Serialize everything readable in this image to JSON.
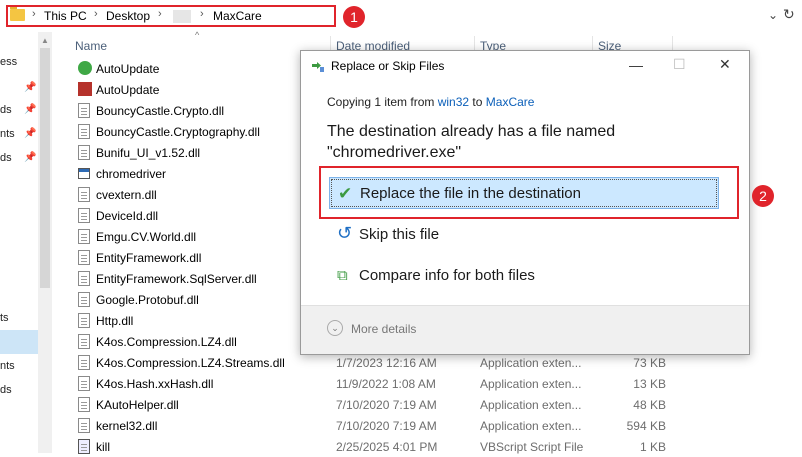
{
  "address": {
    "crumbs": [
      "This PC",
      "Desktop",
      "MaxCare"
    ],
    "separator": "›",
    "refresh_glyph": "↻",
    "dropdown_glyph": "⌄"
  },
  "annotations": {
    "badge1": "1",
    "badge2": "2"
  },
  "nav": {
    "labels": [
      "ess",
      "ds",
      "nts",
      "ds",
      "ts",
      "nts",
      "ds"
    ]
  },
  "columns": {
    "name": "Name",
    "date": "Date modified",
    "type": "Type",
    "size": "Size"
  },
  "files": [
    {
      "name": "AutoUpdate",
      "icon": "green-refresh-icon",
      "date": "",
      "type": "",
      "size": ""
    },
    {
      "name": "AutoUpdate",
      "icon": "red-app-icon",
      "date": "",
      "type": "",
      "size": ""
    },
    {
      "name": "BouncyCastle.Crypto.dll",
      "icon": "dll-file-icon",
      "date": "",
      "type": "",
      "size": ""
    },
    {
      "name": "BouncyCastle.Cryptography.dll",
      "icon": "dll-file-icon",
      "date": "",
      "type": "",
      "size": ""
    },
    {
      "name": "Bunifu_UI_v1.52.dll",
      "icon": "dll-file-icon",
      "date": "",
      "type": "",
      "size": ""
    },
    {
      "name": "chromedriver",
      "icon": "app-window-icon",
      "date": "",
      "type": "",
      "size": ""
    },
    {
      "name": "cvextern.dll",
      "icon": "dll-file-icon",
      "date": "",
      "type": "",
      "size": ""
    },
    {
      "name": "DeviceId.dll",
      "icon": "dll-file-icon",
      "date": "",
      "type": "",
      "size": ""
    },
    {
      "name": "Emgu.CV.World.dll",
      "icon": "dll-file-icon",
      "date": "",
      "type": "",
      "size": ""
    },
    {
      "name": "EntityFramework.dll",
      "icon": "dll-file-icon",
      "date": "",
      "type": "",
      "size": ""
    },
    {
      "name": "EntityFramework.SqlServer.dll",
      "icon": "dll-file-icon",
      "date": "",
      "type": "",
      "size": ""
    },
    {
      "name": "Google.Protobuf.dll",
      "icon": "dll-file-icon",
      "date": "",
      "type": "",
      "size": ""
    },
    {
      "name": "Http.dll",
      "icon": "dll-file-icon",
      "date": "",
      "type": "",
      "size": ""
    },
    {
      "name": "K4os.Compression.LZ4.dll",
      "icon": "dll-file-icon",
      "date": "",
      "type": "",
      "size": ""
    },
    {
      "name": "K4os.Compression.LZ4.Streams.dll",
      "icon": "dll-file-icon",
      "date": "1/7/2023 12:16 AM",
      "type": "Application exten...",
      "size": "73 KB"
    },
    {
      "name": "K4os.Hash.xxHash.dll",
      "icon": "dll-file-icon",
      "date": "11/9/2022 1:08 AM",
      "type": "Application exten...",
      "size": "13 KB"
    },
    {
      "name": "KAutoHelper.dll",
      "icon": "dll-file-icon",
      "date": "7/10/2020 7:19 AM",
      "type": "Application exten...",
      "size": "48 KB"
    },
    {
      "name": "kernel32.dll",
      "icon": "dll-file-icon",
      "date": "7/10/2020 7:19 AM",
      "type": "Application exten...",
      "size": "594 KB"
    },
    {
      "name": "kill",
      "icon": "vbscript-file-icon",
      "date": "2/25/2025 4:01 PM",
      "type": "VBScript Script File",
      "size": "1 KB"
    }
  ],
  "dialog": {
    "title": "Replace or Skip Files",
    "copy_prefix": "Copying 1 item from",
    "copy_from": "win32",
    "copy_to_word": "to",
    "copy_to": "MaxCare",
    "message_line1": "The destination already has a file named",
    "message_line2": "\"chromedriver.exe\"",
    "option_replace": "Replace the file in the destination",
    "option_skip": "Skip this file",
    "option_compare": "Compare info for both files",
    "more_details": "More details",
    "minimize_glyph": "—",
    "maximize_glyph": "☐",
    "close_glyph": "✕"
  },
  "colors": {
    "accent": "#0b5fb9",
    "annotation": "#e0242b",
    "selection": "#cce8ff"
  }
}
